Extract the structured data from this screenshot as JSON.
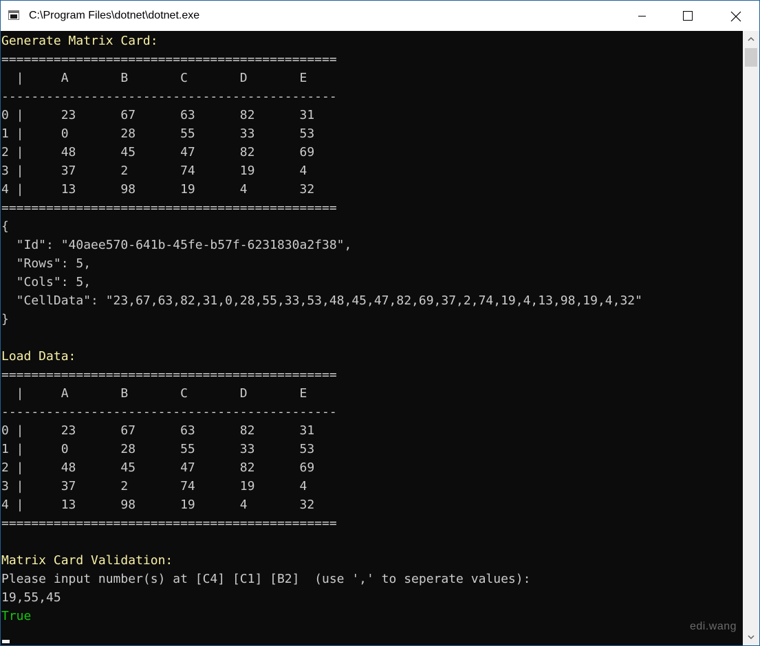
{
  "window": {
    "title": "C:\\Program Files\\dotnet\\dotnet.exe",
    "icon": "console-app-icon",
    "controls": [
      "minimize-icon",
      "maximize-icon",
      "close-icon"
    ]
  },
  "colors": {
    "background": "#0c0c0c",
    "text": "#cccccc",
    "heading": "#f9f1a5",
    "success": "#16c60c",
    "border": "#1f5e99"
  },
  "console": {
    "generate_heading": "Generate Matrix Card:",
    "generate_table": {
      "top_rule": "=============================================",
      "header": "  |     A       B       C       D       E",
      "mid_rule": "---------------------------------------------",
      "rows": [
        "0 |     23      67      63      82      31",
        "1 |     0       28      55      33      53",
        "2 |     48      45      47      82      69",
        "3 |     37      2       74      19      4",
        "4 |     13      98      19      4       32"
      ],
      "bottom_rule": "============================================="
    },
    "json_output": [
      "{",
      "  \"Id\": \"40aee570-641b-45fe-b57f-6231830a2f38\",",
      "  \"Rows\": 5,",
      "  \"Cols\": 5,",
      "  \"CellData\": \"23,67,63,82,31,0,28,55,33,53,48,45,47,82,69,37,2,74,19,4,13,98,19,4,32\"",
      "}"
    ],
    "load_heading": "Load Data:",
    "load_table": {
      "top_rule": "=============================================",
      "header": "  |     A       B       C       D       E",
      "mid_rule": "---------------------------------------------",
      "rows": [
        "0 |     23      67      63      82      31",
        "1 |     0       28      55      33      53",
        "2 |     48      45      47      82      69",
        "3 |     37      2       74      19      4",
        "4 |     13      98      19      4       32"
      ],
      "bottom_rule": "============================================="
    },
    "validation_heading": "Matrix Card Validation:",
    "prompt": "Please input number(s) at [C4] [C1] [B2]  (use ',' to seperate values):",
    "user_input": "19,55,45",
    "result": "True"
  },
  "watermark": "edi.wang"
}
